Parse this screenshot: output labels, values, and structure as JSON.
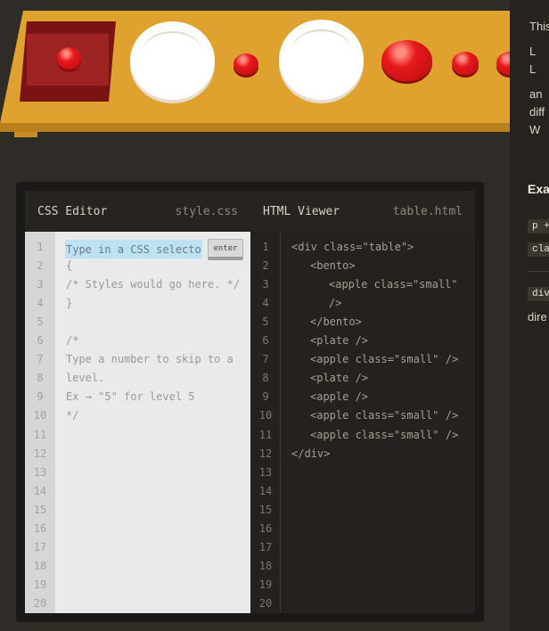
{
  "scene": {
    "table_items": [
      "bento",
      "apple-small",
      "plate",
      "apple-small",
      "plate",
      "apple",
      "apple-small",
      "apple-small"
    ]
  },
  "side_panel": {
    "text_lines": [
      "This",
      "L",
      "L",
      "an",
      "diff",
      "W"
    ],
    "example_title": "Exa",
    "codes": [
      "p +",
      "cla",
      "div"
    ],
    "tail_text": "dire"
  },
  "css_editor": {
    "title": "CSS Editor",
    "filename": "style.css",
    "input_placeholder": "Type in a CSS selector",
    "enter_label": "enter",
    "line_numbers": [
      "1",
      "2",
      "3",
      "4",
      "5",
      "6",
      "7",
      "8",
      "9",
      "10",
      "11",
      "12",
      "13",
      "14",
      "15",
      "16",
      "17",
      "18",
      "19",
      "20"
    ],
    "lines": [
      "{",
      "/* Styles would go here. */",
      "}",
      "",
      "/*",
      "Type a number to skip to a",
      "level.",
      "Ex → \"5\" for level 5",
      "*/"
    ]
  },
  "html_viewer": {
    "title": "HTML Viewer",
    "filename": "table.html",
    "line_numbers": [
      "1",
      "2",
      "3",
      "4",
      "5",
      "6",
      "7",
      "8",
      "9",
      "10",
      "11",
      "12",
      "13",
      "14",
      "15",
      "16",
      "17",
      "18",
      "19",
      "20"
    ],
    "lines": [
      {
        "text": "<div class=\"table\">",
        "indent": 0
      },
      {
        "text": "<bento>",
        "indent": 1
      },
      {
        "text": "<apple class=\"small\"",
        "indent": 2
      },
      {
        "text": "/>",
        "indent": 2
      },
      {
        "text": "</bento>",
        "indent": 1
      },
      {
        "text": "<plate />",
        "indent": 1
      },
      {
        "text": "<apple class=\"small\" />",
        "indent": 1
      },
      {
        "text": "<plate />",
        "indent": 1
      },
      {
        "text": "<apple />",
        "indent": 1
      },
      {
        "text": "<apple class=\"small\" />",
        "indent": 1
      },
      {
        "text": "<apple class=\"small\" />",
        "indent": 1
      },
      {
        "text": "</div>",
        "indent": 0
      }
    ]
  },
  "colors": {
    "background": "#2f2b27",
    "table": "#e0a22e",
    "apple": "#e8191c",
    "bento": "#7a1414",
    "selector_highlight": "#bde3f3"
  }
}
